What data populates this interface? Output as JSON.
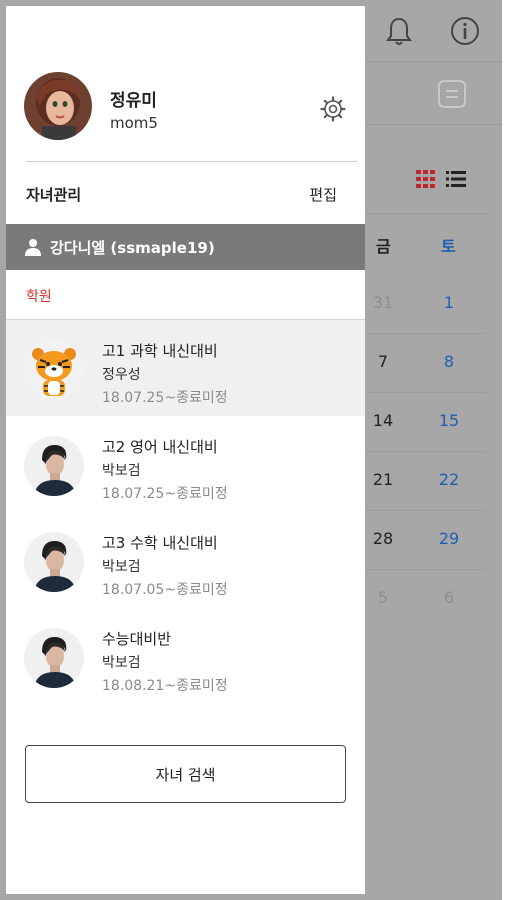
{
  "calendar": {
    "weekdays": [
      {
        "label": "금",
        "color": "#222222"
      },
      {
        "label": "토",
        "color": "#1e5fb4"
      }
    ],
    "weeks": [
      {
        "fri": "31",
        "sat": "1",
        "fri_color": "#8f8f8f",
        "sat_color": "#1e5fb4"
      },
      {
        "fri": "7",
        "sat": "8",
        "fri_color": "#222222",
        "sat_color": "#1e5fb4"
      },
      {
        "fri": "14",
        "sat": "15",
        "fri_color": "#222222",
        "sat_color": "#1e5fb4"
      },
      {
        "fri": "21",
        "sat": "22",
        "fri_color": "#222222",
        "sat_color": "#1e5fb4"
      },
      {
        "fri": "28",
        "sat": "29",
        "fri_color": "#222222",
        "sat_color": "#1e5fb4"
      },
      {
        "fri": "5",
        "sat": "6",
        "fri_color": "#8f8f8f",
        "sat_color": "#8f8f8f"
      }
    ],
    "icons": [
      "bell-icon",
      "info-icon",
      "memo-icon",
      "grid-view-icon",
      "list-view-icon"
    ],
    "accent": "#c0262d"
  },
  "profile": {
    "name": "정유미",
    "id": "mom5",
    "icons": [
      "avatar",
      "gear-icon"
    ]
  },
  "children_section": {
    "title": "자녀관리",
    "edit_label": "편집"
  },
  "selected_child": {
    "label": "강다니엘 (ssmaple19)",
    "icon": "person-icon"
  },
  "academy_label": "학원",
  "classes": [
    {
      "title": "고1 과학 내신대비",
      "teacher": "정우성",
      "period": "18.07.25~종료미정",
      "avatar": "tiger-mascot",
      "selected": true
    },
    {
      "title": "고2 영어 내신대비",
      "teacher": "박보검",
      "period": "18.07.25~종료미정",
      "avatar": "teacher-photo",
      "selected": false
    },
    {
      "title": "고3 수학 내신대비",
      "teacher": "박보검",
      "period": "18.07.05~종료미정",
      "avatar": "teacher-photo",
      "selected": false
    },
    {
      "title": "수능대비반",
      "teacher": "박보검",
      "period": "18.08.21~종료미정",
      "avatar": "teacher-photo",
      "selected": false
    }
  ],
  "search_button_label": "자녀 검색",
  "colors": {
    "child_bar": "#7a7a7a",
    "academy_label": "#d0342c",
    "dim_overlay": "#a7a7a7"
  }
}
